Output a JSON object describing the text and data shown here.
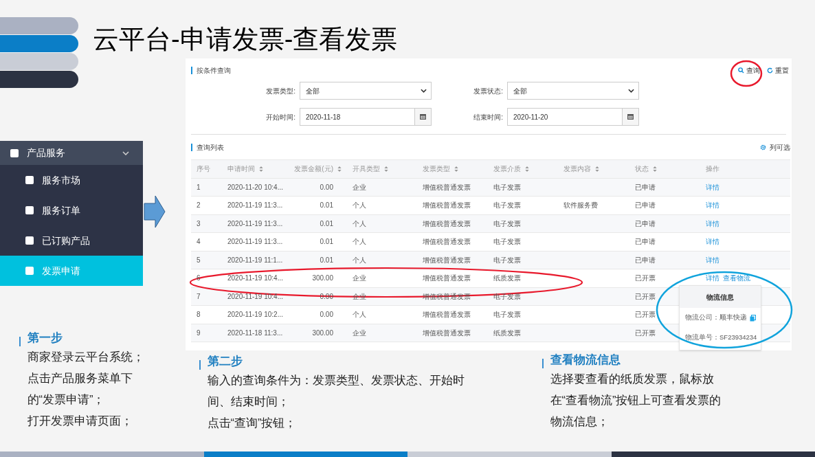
{
  "slide_title": "云平台-申请发票-查看发票",
  "sidebar": {
    "group": {
      "label": "产品服务",
      "expanded": true
    },
    "items": [
      {
        "label": "服务市场",
        "selected": false
      },
      {
        "label": "服务订单",
        "selected": false
      },
      {
        "label": "已订购产品",
        "selected": false
      },
      {
        "label": "发票申请",
        "selected": true
      }
    ]
  },
  "query_panel": {
    "title": "按条件查询",
    "buttons": [
      {
        "label": "查询",
        "kind": "search"
      },
      {
        "label": "重置",
        "kind": "reset"
      }
    ],
    "fields": [
      {
        "label": "发票类型:",
        "kind": "select",
        "value": "全部"
      },
      {
        "label": "发票状态:",
        "kind": "select",
        "value": "全部"
      },
      {
        "label": "开始时间:",
        "kind": "date",
        "value": "2020-11-18"
      },
      {
        "label": "结束时间:",
        "kind": "date",
        "value": "2020-11-20"
      }
    ]
  },
  "list_panel": {
    "title": "查询列表",
    "column_button": "列可选",
    "columns": [
      {
        "label": "序号",
        "kind": "index"
      },
      {
        "label": "申请时间",
        "kind": "text"
      },
      {
        "label": "发票金额(元)",
        "kind": "number"
      },
      {
        "label": "开具类型",
        "kind": "text"
      },
      {
        "label": "发票类型",
        "kind": "text"
      },
      {
        "label": "发票介质",
        "kind": "text"
      },
      {
        "label": "发票内容",
        "kind": "text"
      },
      {
        "label": "状态",
        "kind": "text"
      },
      {
        "label": "操作",
        "kind": "action"
      }
    ],
    "rows": [
      {
        "cells": [
          "1",
          "2020-11-20 10:4...",
          "0.00",
          "企业",
          "增值税普通发票",
          "电子发票",
          "",
          "已申请"
        ],
        "actions": [
          "详情"
        ]
      },
      {
        "cells": [
          "2",
          "2020-11-19 11:3...",
          "0.01",
          "个人",
          "增值税普通发票",
          "电子发票",
          "软件服务费",
          "已申请"
        ],
        "actions": [
          "详情"
        ]
      },
      {
        "cells": [
          "3",
          "2020-11-19 11:3...",
          "0.01",
          "个人",
          "增值税普通发票",
          "电子发票",
          "",
          "已申请"
        ],
        "actions": [
          "详情"
        ]
      },
      {
        "cells": [
          "4",
          "2020-11-19 11:3...",
          "0.01",
          "个人",
          "增值税普通发票",
          "电子发票",
          "",
          "已申请"
        ],
        "actions": [
          "详情"
        ]
      },
      {
        "cells": [
          "5",
          "2020-11-19 11:1...",
          "0.01",
          "个人",
          "增值税普通发票",
          "电子发票",
          "",
          "已申请"
        ],
        "actions": [
          "详情"
        ]
      },
      {
        "cells": [
          "6",
          "2020-11-19 10:4...",
          "300.00",
          "企业",
          "增值税普通发票",
          "纸质发票",
          "",
          "已开票"
        ],
        "actions": [
          "详情",
          "查看物流"
        ]
      },
      {
        "cells": [
          "7",
          "2020-11-19 10:4...",
          "0.00",
          "企业",
          "增值税普通发票",
          "电子发票",
          "",
          "已开票"
        ],
        "actions": []
      },
      {
        "cells": [
          "8",
          "2020-11-19 10:2...",
          "0.00",
          "个人",
          "增值税普通发票",
          "电子发票",
          "",
          "已开票"
        ],
        "actions": []
      },
      {
        "cells": [
          "9",
          "2020-11-18 11:3...",
          "300.00",
          "企业",
          "增值税普通发票",
          "纸质发票",
          "",
          "已开票"
        ],
        "actions": []
      }
    ]
  },
  "popover": {
    "title": "物流信息",
    "rows": [
      {
        "label": "物流公司：",
        "value": "顺丰快递",
        "copy": true
      },
      {
        "label": "物流单号：",
        "value": "SF23934234"
      }
    ]
  },
  "steps": [
    {
      "title": "第一步",
      "paragraphs": [
        "商家登录云平台系统；",
        "点击产品服务菜单下的“发票申请”；",
        "打开发票申请页面；"
      ]
    },
    {
      "title": "第二步",
      "paragraphs": [
        "输入的查询条件为：发票类型、发票状态、开始时间、结束时间；",
        "点击“查询”按钮；"
      ]
    },
    {
      "title": "查看物流信息",
      "paragraphs": [
        "选择要查看的纸质发票，鼠标放在“查看物流”按钮上可查看发票的物流信息；"
      ]
    }
  ]
}
